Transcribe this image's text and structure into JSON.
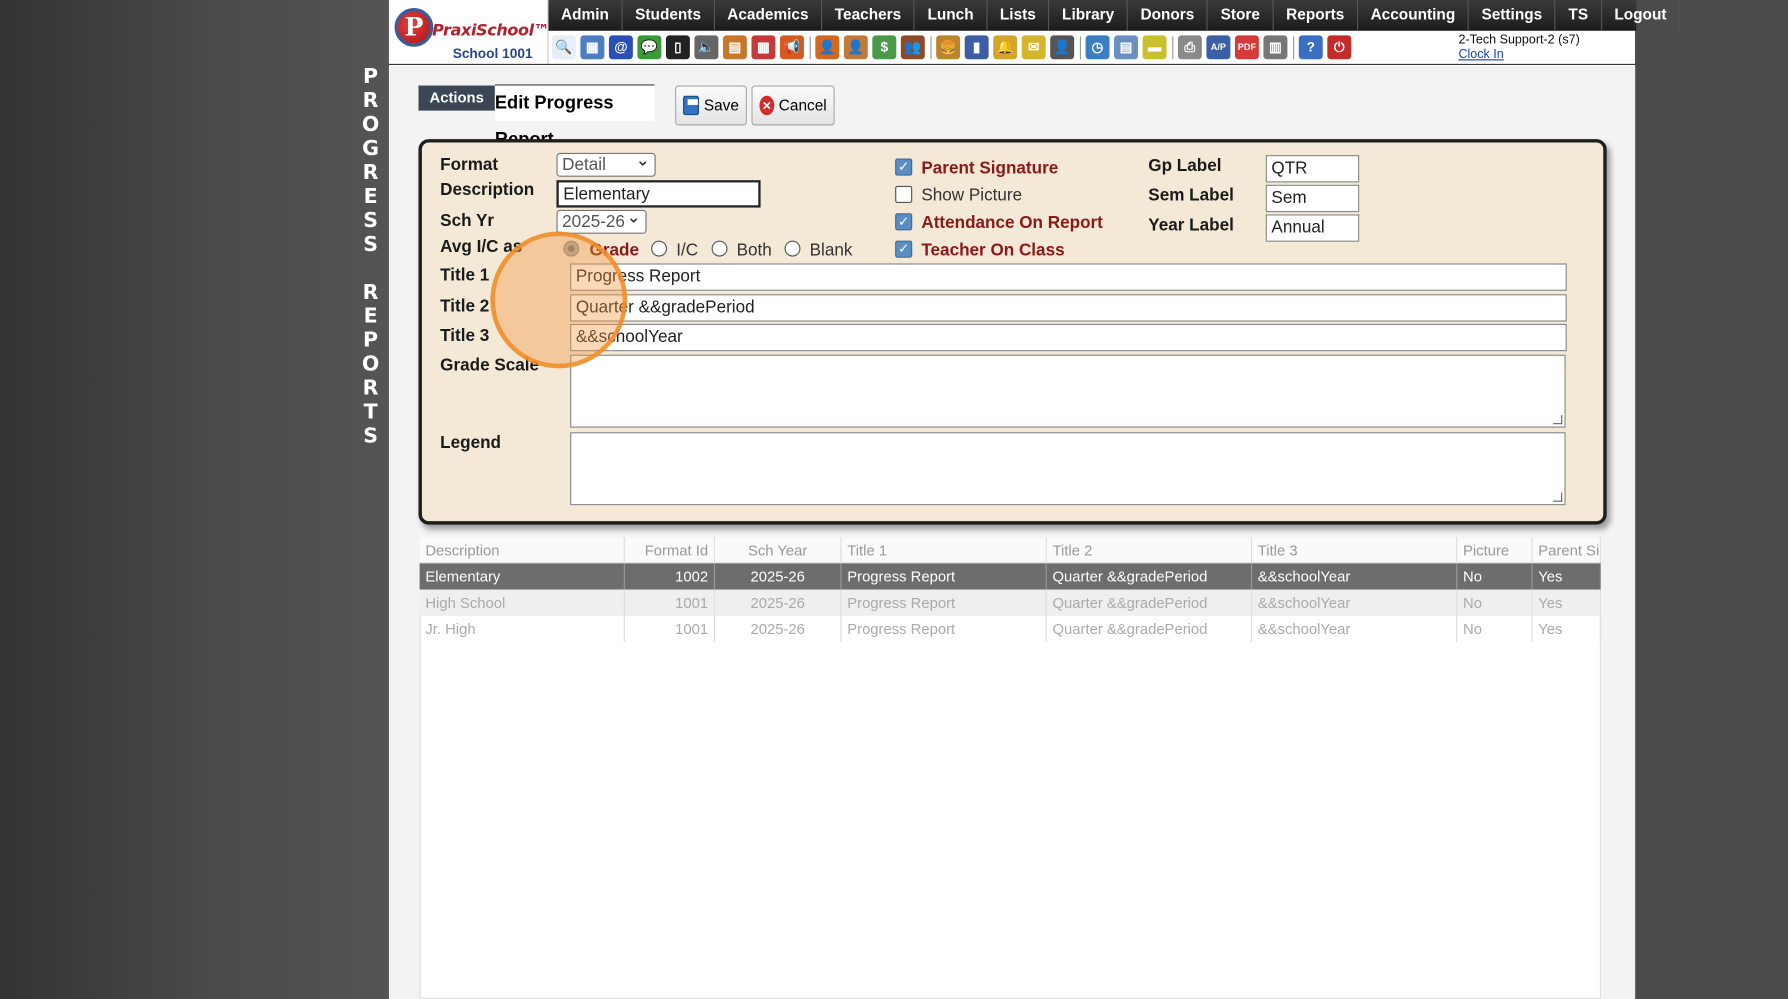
{
  "side_title": [
    "P",
    "R",
    "O",
    "G",
    "R",
    "E",
    "S",
    "S",
    "",
    "R",
    "E",
    "P",
    "O",
    "R",
    "T",
    "S"
  ],
  "logo": {
    "mark": "P",
    "brand": "PraxiSchool™",
    "school": "School 1001"
  },
  "menu": [
    "Admin",
    "Students",
    "Academics",
    "Teachers",
    "Lunch",
    "Lists",
    "Library",
    "Donors",
    "Store",
    "Reports",
    "Accounting",
    "Settings",
    "TS",
    "Logout"
  ],
  "toolbar_icons": [
    {
      "name": "search-icon",
      "glyph": "🔍",
      "color": "#e8eef7"
    },
    {
      "name": "calendar-grid-icon",
      "glyph": "▦",
      "color": "#4a7fc1"
    },
    {
      "name": "email-icon",
      "glyph": "@",
      "color": "#2a4fb5"
    },
    {
      "name": "chat-icon",
      "glyph": "💬",
      "color": "#3a9a3a"
    },
    {
      "name": "mobile-icon",
      "glyph": "▯",
      "color": "#222"
    },
    {
      "name": "speaker-icon",
      "glyph": "🔈",
      "color": "#666"
    },
    {
      "name": "schedule-icon",
      "glyph": "▤",
      "color": "#c8762b"
    },
    {
      "name": "calendar-icon",
      "glyph": "▦",
      "color": "#c73a3a"
    },
    {
      "name": "megaphone-icon",
      "glyph": "📢",
      "color": "#d45b20"
    },
    {
      "name": "teacher-icon",
      "glyph": "👤",
      "color": "#d2691e"
    },
    {
      "name": "student-icon",
      "glyph": "👤",
      "color": "#c07a3a"
    },
    {
      "name": "money-icon",
      "glyph": "$",
      "color": "#4a9a4a"
    },
    {
      "name": "parents-icon",
      "glyph": "👥",
      "color": "#8b4a2a"
    },
    {
      "name": "lunch-icon",
      "glyph": "🍔",
      "color": "#b8862b"
    },
    {
      "name": "book-icon",
      "glyph": "▮",
      "color": "#3a5fa5"
    },
    {
      "name": "bell-icon",
      "glyph": "🔔",
      "color": "#d4a52b"
    },
    {
      "name": "note-icon",
      "glyph": "✉",
      "color": "#d4b52b"
    },
    {
      "name": "staff-icon",
      "glyph": "👤",
      "color": "#555"
    },
    {
      "name": "clock-icon",
      "glyph": "◷",
      "color": "#3a7fc1"
    },
    {
      "name": "list-icon",
      "glyph": "▤",
      "color": "#6a8fc1"
    },
    {
      "name": "card-icon",
      "glyph": "▬",
      "color": "#c8c12b"
    },
    {
      "name": "printer-icon",
      "glyph": "⎙",
      "color": "#8a8a8a"
    },
    {
      "name": "ap-icon",
      "glyph": "A/P",
      "color": "#3a5fa5"
    },
    {
      "name": "pdf-icon",
      "glyph": "PDF",
      "color": "#d43a3a"
    },
    {
      "name": "register-icon",
      "glyph": "▥",
      "color": "#777"
    },
    {
      "name": "help-icon",
      "glyph": "?",
      "color": "#3a6fc1"
    },
    {
      "name": "power-icon",
      "glyph": "⏻",
      "color": "#c42b2b"
    }
  ],
  "user": {
    "name": "2-Tech Support-2 (s7)",
    "clock_link": "Clock In"
  },
  "actions": {
    "tab_label": "Actions",
    "title": "Edit Progress Report",
    "save_label": "Save",
    "cancel_label": "Cancel"
  },
  "form": {
    "format_label": "Format",
    "format_value": "Detail",
    "description_label": "Description",
    "description_value": "Elementary",
    "sch_yr_label": "Sch Yr",
    "sch_yr_value": "2025-26",
    "avg_label": "Avg I/C as",
    "avg_options": [
      "Grade",
      "I/C",
      "Both",
      "Blank"
    ],
    "avg_selected": "Grade",
    "title1_label": "Title 1",
    "title1_value": "Progress Report",
    "title2_label": "Title 2",
    "title2_value": "Quarter &&gradePeriod",
    "title3_label": "Title 3",
    "title3_value": "&&schoolYear",
    "grade_scale_label": "Grade Scale",
    "legend_label": "Legend",
    "checks": [
      {
        "label": "Parent Signature",
        "checked": true
      },
      {
        "label": "Show Picture",
        "checked": false
      },
      {
        "label": "Attendance On Report",
        "checked": true
      },
      {
        "label": "Teacher On Class",
        "checked": true
      }
    ],
    "gp_label": "Gp Label",
    "gp_value": "QTR",
    "sem_label": "Sem Label",
    "sem_value": "Sem",
    "year_label": "Year Label",
    "year_value": "Annual"
  },
  "grid": {
    "columns": [
      "Description",
      "Format Id",
      "Sch Year",
      "Title 1",
      "Title 2",
      "Title 3",
      "Picture",
      "Parent Sig"
    ],
    "rows": [
      [
        "Elementary",
        "1002",
        "2025-26",
        "Progress Report",
        "Quarter &&gradePeriod",
        "&&schoolYear",
        "No",
        "Yes"
      ],
      [
        "High School",
        "1001",
        "2025-26",
        "Progress Report",
        "Quarter &&gradePeriod",
        "&&schoolYear",
        "No",
        "Yes"
      ],
      [
        "Jr. High",
        "1001",
        "2025-26",
        "Progress Report",
        "Quarter &&gradePeriod",
        "&&schoolYear",
        "No",
        "Yes"
      ]
    ]
  }
}
